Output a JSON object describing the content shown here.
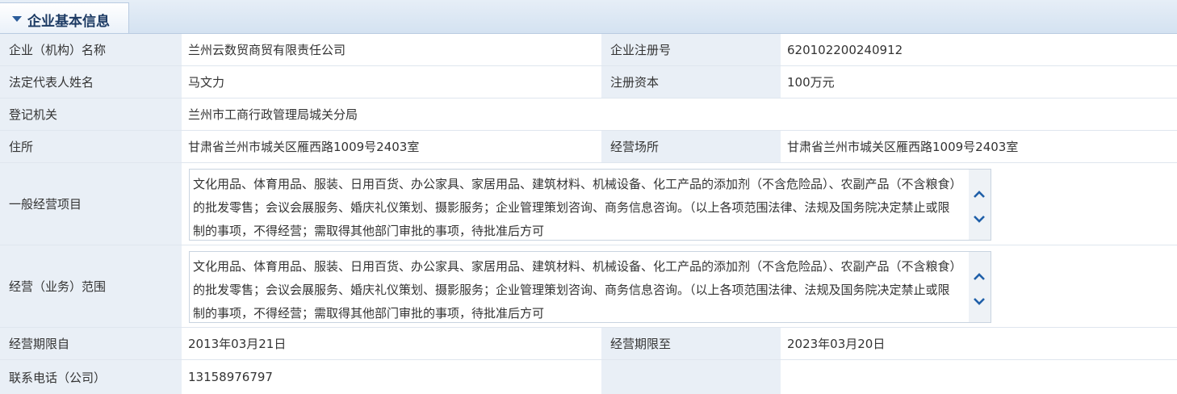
{
  "section": {
    "title": "企业基本信息"
  },
  "fields": {
    "name": {
      "label": "企业（机构）名称",
      "value": "兰州云数贸商贸有限责任公司"
    },
    "reg_no": {
      "label": "企业注册号",
      "value": "620102200240912"
    },
    "legal_rep": {
      "label": "法定代表人姓名",
      "value": "马文力"
    },
    "capital": {
      "label": "注册资本",
      "value": "100万元"
    },
    "authority": {
      "label": "登记机关",
      "value": "兰州市工商行政管理局城关分局"
    },
    "address": {
      "label": "住所",
      "value": "甘肃省兰州市城关区雁西路1009号2403室"
    },
    "premises": {
      "label": "经营场所",
      "value": "甘肃省兰州市城关区雁西路1009号2403室"
    },
    "general_scope": {
      "label": "一般经营项目",
      "value": "文化用品、体育用品、服装、日用百货、办公家具、家居用品、建筑材料、机械设备、化工产品的添加剂（不含危险品）、农副产品（不含粮食）的批发零售；会议会展服务、婚庆礼仪策划、摄影服务；企业管理策划咨询、商务信息咨询。（以上各项范围法律、法规及国务院决定禁止或限制的事项，不得经营；需取得其他部门审批的事项，待批准后方可"
    },
    "business_scope": {
      "label": "经营（业务）范围",
      "value": "文化用品、体育用品、服装、日用百货、办公家具、家居用品、建筑材料、机械设备、化工产品的添加剂（不含危险品）、农副产品（不含粮食）的批发零售；会议会展服务、婚庆礼仪策划、摄影服务；企业管理策划咨询、商务信息咨询。（以上各项范围法律、法规及国务院决定禁止或限制的事项，不得经营；需取得其他部门审批的事项，待批准后方可"
    },
    "term_from": {
      "label": "经营期限自",
      "value": "2013年03月21日"
    },
    "term_to": {
      "label": "经营期限至",
      "value": "2023年03月20日"
    },
    "phone": {
      "label": "联系电话（公司）",
      "value": "13158976797"
    }
  },
  "icons": {
    "collapse": "triangle-down-icon",
    "scroll_up": "chevron-up-icon",
    "scroll_down": "chevron-down-icon"
  },
  "colors": {
    "label_bg": "#e9eff6",
    "accent": "#1f5fa8",
    "header_bg": "#d4e2f1"
  }
}
